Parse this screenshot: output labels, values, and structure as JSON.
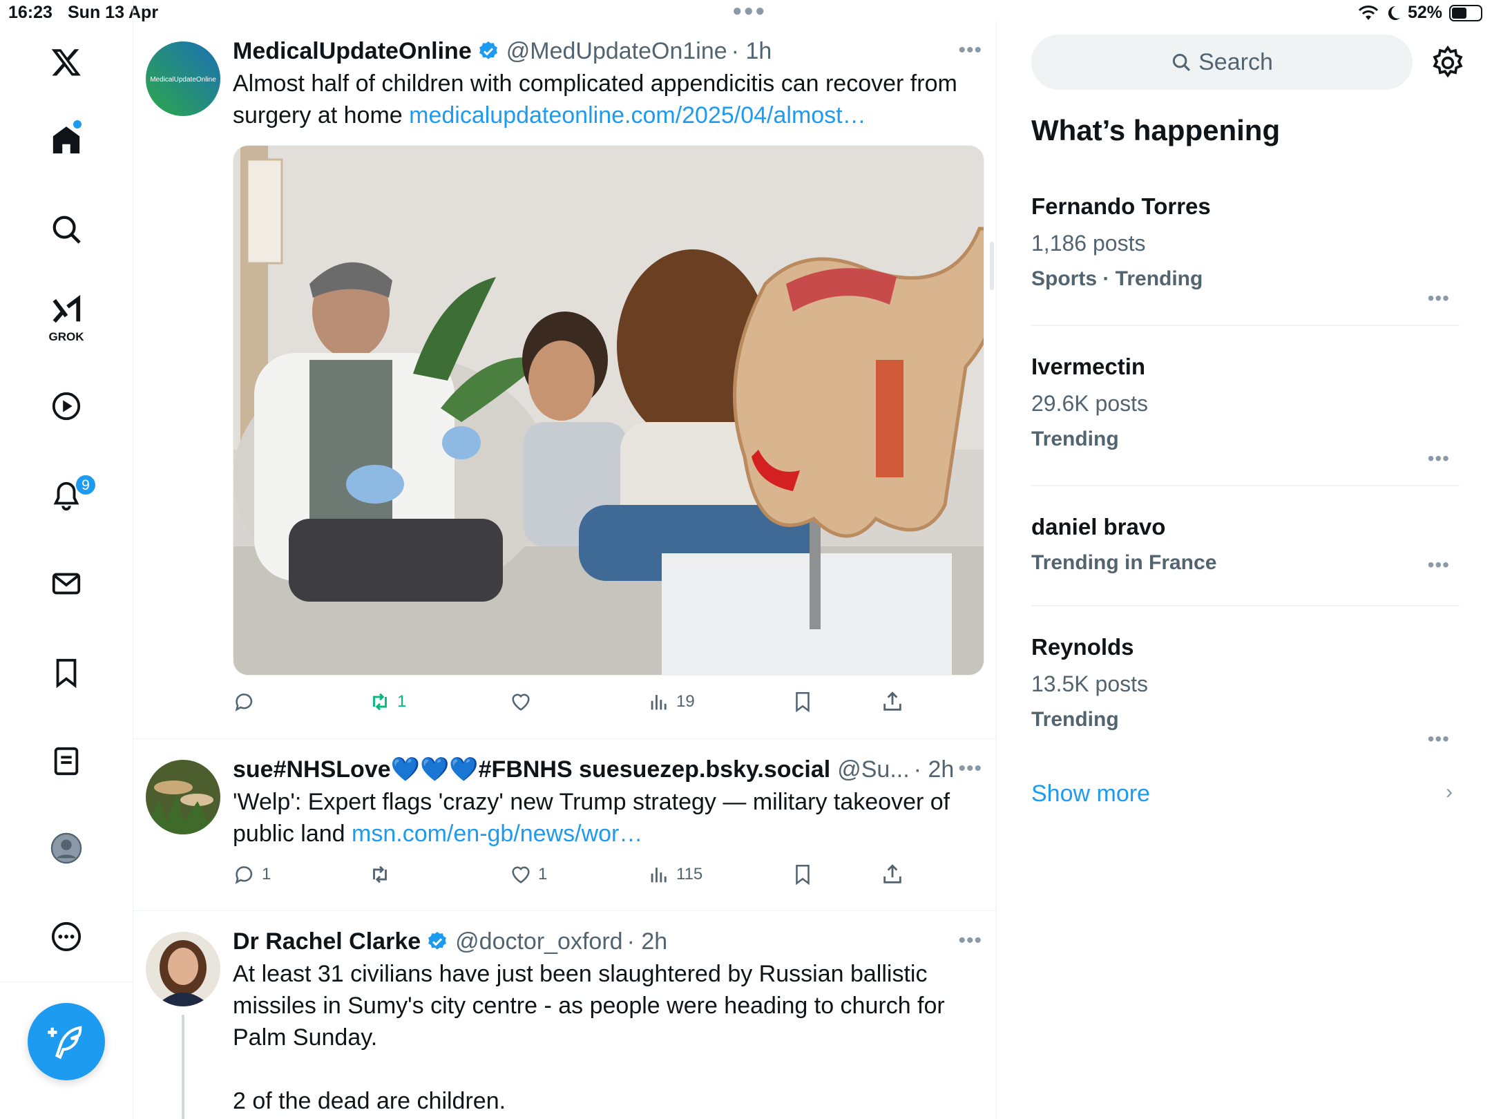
{
  "status_bar": {
    "time": "16:23",
    "date": "Sun 13 Apr",
    "battery": "52%",
    "battery_level": 0.52
  },
  "nav": {
    "grok_label": "GROK",
    "notifications_count": "9",
    "icons": [
      "x-logo-icon",
      "home-icon",
      "search-icon",
      "grok-icon",
      "video-icon",
      "bell-icon",
      "mail-icon",
      "bookmark-icon",
      "lists-icon",
      "profile-icon",
      "more-icon",
      "compose-icon"
    ]
  },
  "feed": {
    "tweets": [
      {
        "name": "MedicalUpdateOnline",
        "verified": true,
        "handle": "@MedUpdateOn1ine",
        "time": "· 1h",
        "text": "Almost half of children with complicated appendicitis can recover from surgery at home ",
        "link": "medicalupdateonline.com/2025/04/almost…",
        "avatar_text": "MedicalUpdateOnline",
        "stats": {
          "replies": "",
          "reposts": "1",
          "likes": "",
          "views": "19"
        }
      },
      {
        "name": "sue#NHSLove💙💙💙#FBNHS suesuezep.bsky.social",
        "verified": false,
        "handle": "@Su...",
        "time": "· 2h",
        "text": "'Welp': Expert flags 'crazy' new Trump strategy — military takeover of public land ",
        "link": "msn.com/en-gb/news/wor…",
        "stats": {
          "replies": "1",
          "reposts": "",
          "likes": "1",
          "views": "115"
        }
      },
      {
        "name": "Dr Rachel Clarke",
        "verified": true,
        "handle": "@doctor_oxford",
        "time": "· 2h",
        "text": "At least 31 civilians have just been slaughtered by Russian ballistic missiles in Sumy's city centre - as people were heading to church for Palm Sunday.\n\n2 of the dead are children."
      }
    ]
  },
  "sidebar": {
    "search_placeholder": "Search",
    "title": "What’s happening",
    "trends": [
      {
        "name": "Fernando Torres",
        "count": "1,186 posts",
        "category": "Sports · Trending"
      },
      {
        "name": "Ivermectin",
        "count": "29.6K posts",
        "category": "Trending"
      },
      {
        "name": "daniel bravo",
        "count": "",
        "category": "Trending in France"
      },
      {
        "name": "Reynolds",
        "count": "13.5K posts",
        "category": "Trending"
      }
    ],
    "show_more": "Show more"
  },
  "colors": {
    "accent": "#1d9bf0",
    "repost_green": "#00ba7c",
    "secondary_text": "#536471"
  }
}
